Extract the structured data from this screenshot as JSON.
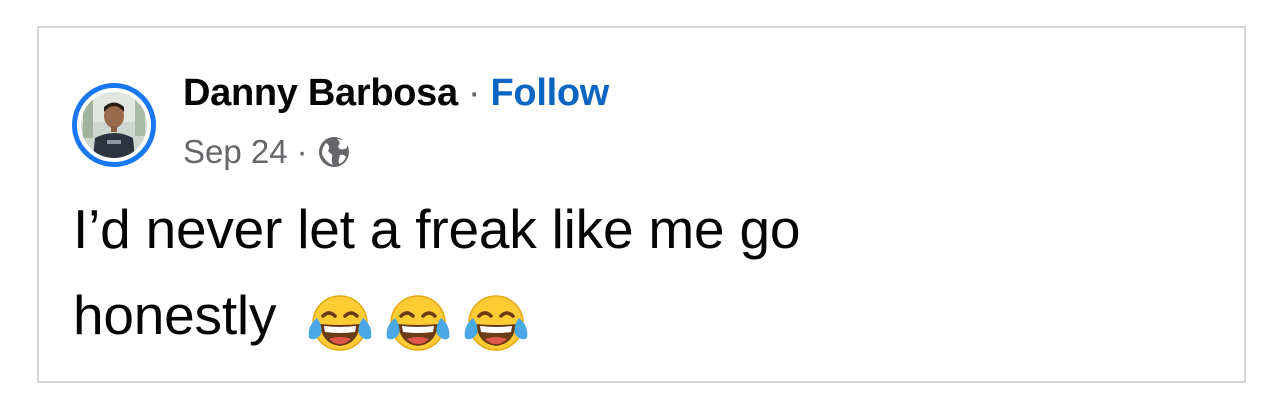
{
  "post": {
    "author": "Danny Barbosa",
    "separator": "·",
    "follow_label": "Follow",
    "date": "Sep 24",
    "audience_icon": "globe-icon",
    "text_line1": "I’d never let a freak like me go",
    "text_line2": "honestly",
    "emojis": [
      "face-with-tears-of-joy",
      "face-with-tears-of-joy",
      "face-with-tears-of-joy"
    ]
  },
  "colors": {
    "avatar_ring": "#1877f2",
    "follow": "#0a66c2",
    "meta": "#65676b",
    "text": "#050505",
    "card_border": "#d6d6d6"
  }
}
